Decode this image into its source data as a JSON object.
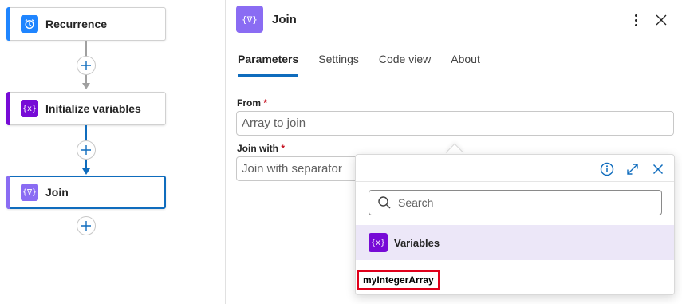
{
  "canvas": {
    "cards": [
      {
        "label": "Recurrence",
        "icon": "alarm-clock-icon",
        "icon_glyph": "⏱",
        "color": "#1f85ff"
      },
      {
        "label": "Initialize variables",
        "icon": "variable-icon",
        "icon_glyph": "{x}",
        "color": "#770bd6"
      },
      {
        "label": "Join",
        "icon": "join-icon",
        "icon_glyph": "{∇}",
        "color": "#8a6cf3"
      }
    ],
    "connector_gray": "#a0a0a0",
    "connector_blue": "#0f6cbd"
  },
  "panel": {
    "title": "Join",
    "icon_glyph": "{∇}",
    "tabs": [
      "Parameters",
      "Settings",
      "Code view",
      "About"
    ],
    "active_tab": "Parameters",
    "fields": [
      {
        "label": "From",
        "required_mark": "*",
        "placeholder": "Array to join"
      },
      {
        "label": "Join with",
        "required_mark": "*",
        "placeholder": "Join with separator"
      }
    ]
  },
  "popup": {
    "search_placeholder": "Search",
    "section_label": "Variables",
    "section_icon_glyph": "{x}",
    "items": [
      "myIntegerArray"
    ]
  }
}
